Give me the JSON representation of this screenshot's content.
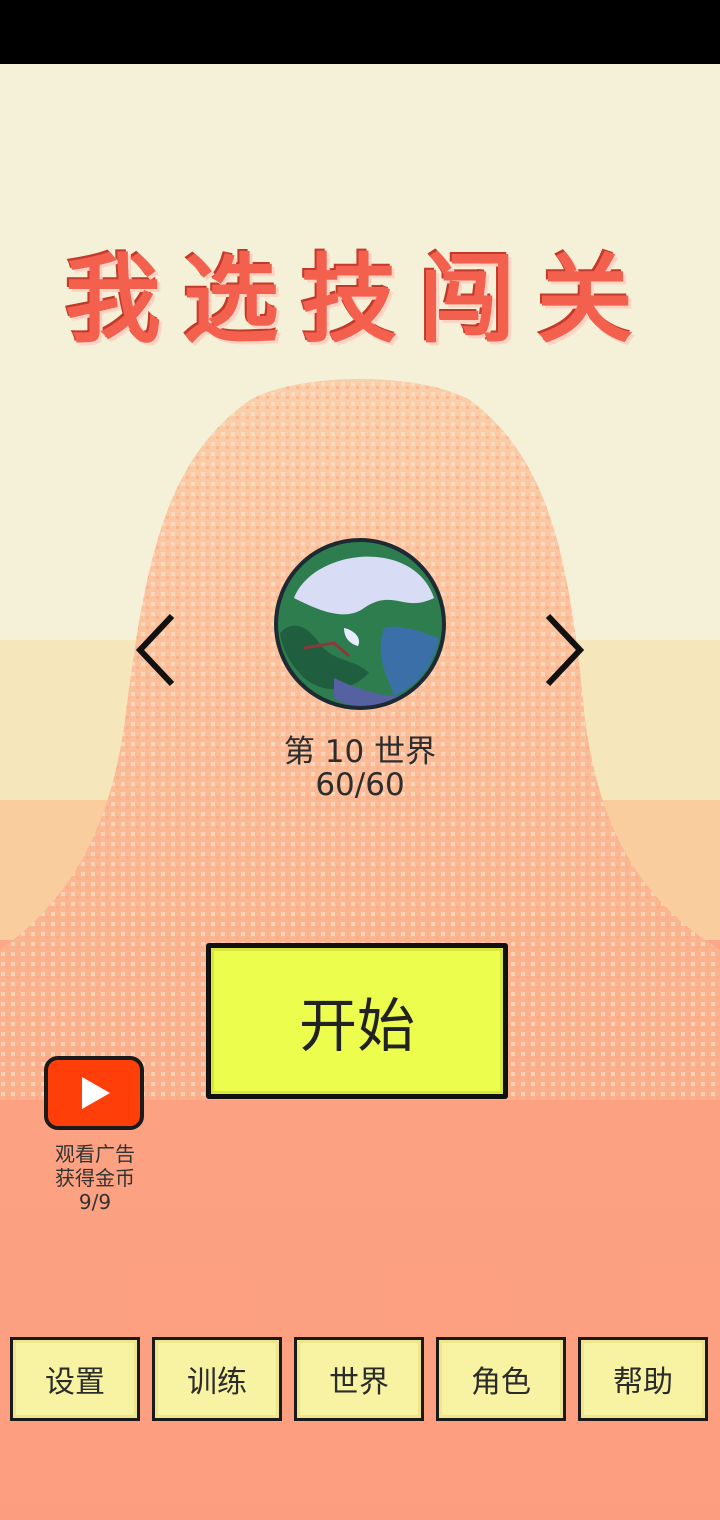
{
  "title": "我选技闯关",
  "world": {
    "name": "第 10 世界",
    "progress": "60/60",
    "planet_icon": "planet-icon"
  },
  "navigation": {
    "prev_icon": "chevron-left-icon",
    "next_icon": "chevron-right-icon"
  },
  "start_button": {
    "label": "开始"
  },
  "ad_reward": {
    "icon": "play-icon",
    "line1": "观看广告",
    "line2": "获得金币",
    "count": "9/9"
  },
  "bottom_nav": {
    "items": [
      {
        "label": "设置"
      },
      {
        "label": "训练"
      },
      {
        "label": "世界"
      },
      {
        "label": "角色"
      },
      {
        "label": "帮助"
      }
    ]
  },
  "colors": {
    "title": "#f3614e",
    "start_button": "#ecfd4d",
    "nav_button": "#f7f3a3",
    "ad_button": "#fe3f0a",
    "mountain": "#fbbd96"
  }
}
